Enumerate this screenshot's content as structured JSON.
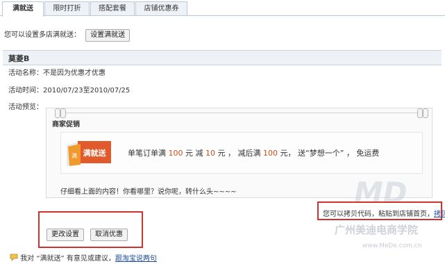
{
  "tabs": [
    {
      "label": "满就送",
      "active": true
    },
    {
      "label": "限时打折",
      "active": false
    },
    {
      "label": "搭配套餐",
      "active": false
    },
    {
      "label": "店铺优惠券",
      "active": false
    }
  ],
  "hint": {
    "text": "您可以设置多店满就送：",
    "button": "设置满就送"
  },
  "shop": {
    "name": "莫菱B"
  },
  "info": {
    "name_label": "活动名称：",
    "name_value": "不是因为优惠才优惠",
    "time_label": "活动时间：",
    "time_value": "2010/07/23至2010/07/25",
    "preview_label": "活动预览："
  },
  "promo": {
    "title": "商家促销",
    "badge_text": "满就送",
    "badge_tag": "满",
    "line": {
      "p1": "单笔订单满 ",
      "n1": "100",
      "p2": " 元 减 ",
      "n2": "10",
      "p3": " 元 ， 减后满 ",
      "n3": "100",
      "p4": " 元， 送“梦想一个” ， 免运费"
    },
    "caption": "仔细看上面的内容！你看哪里？说你呢，转什么头~~~~"
  },
  "copy": {
    "text": "您可以拷贝代码，粘贴到店铺首页，",
    "link": "拷贝代码"
  },
  "actions": {
    "change": "更改设置",
    "cancel": "取消优惠"
  },
  "footer": {
    "text": "我对 “满就送” 有意见或建议，",
    "link": "跟淘宝说两句"
  },
  "watermark": {
    "line1": "广州美迪电商学院",
    "line2": "www.MeDe.com.cn"
  },
  "colors": {
    "accent_red": "#d0312d",
    "link_blue": "#1f4ea1",
    "number_orange": "#c8511b",
    "tab_bg": "#eef2f7"
  }
}
